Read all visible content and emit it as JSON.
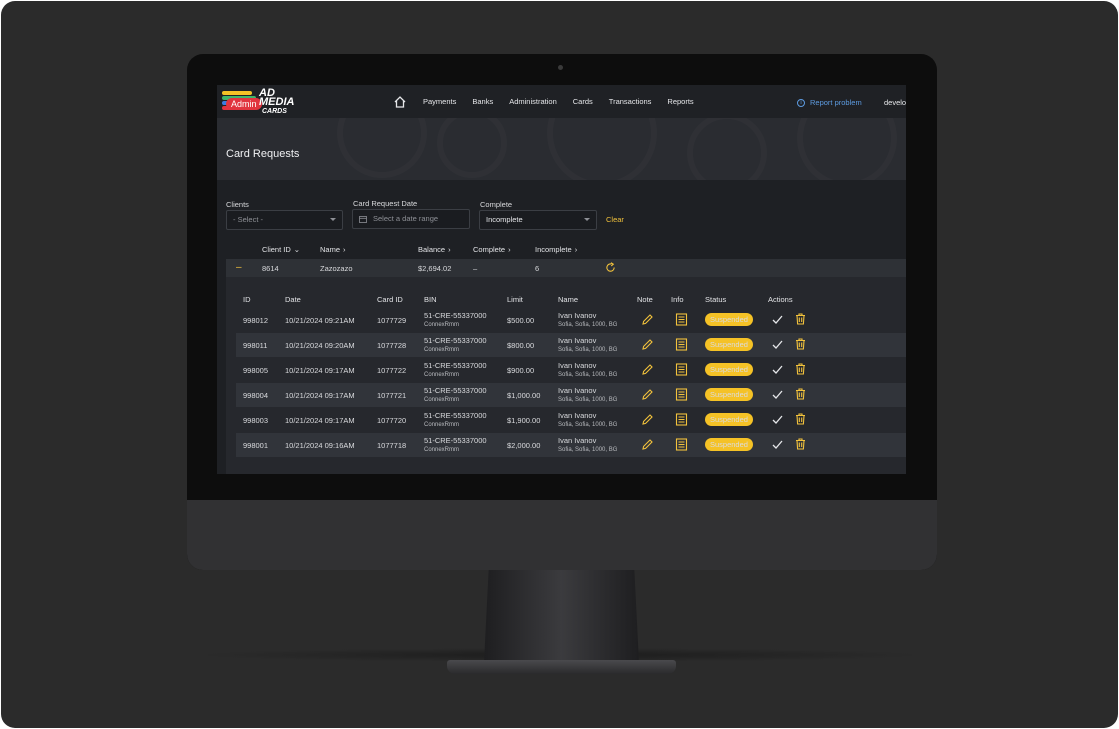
{
  "app": {
    "logo_badge": "Admin",
    "logo_line1": "AD",
    "logo_line2": "MEDIA",
    "logo_line3": "CARDS"
  },
  "nav": {
    "items": [
      "Payments",
      "Banks",
      "Administration",
      "Cards",
      "Transactions",
      "Reports"
    ],
    "report_problem": "Report problem",
    "user": "develo"
  },
  "page": {
    "title": "Card Requests"
  },
  "filters": {
    "clients_label": "Clients",
    "clients_value": "- Select -",
    "date_label": "Card Request Date",
    "date_placeholder": "Select a date range",
    "complete_label": "Complete",
    "complete_value": "Incomplete",
    "clear": "Clear"
  },
  "summary": {
    "headers": {
      "client_id": "Client ID",
      "name": "Name",
      "balance": "Balance",
      "complete": "Complete",
      "incomplete": "Incomplete"
    },
    "row": {
      "client_id": "8614",
      "name": "Zazozazo",
      "balance": "$2,694.02",
      "complete": "–",
      "incomplete": "6"
    }
  },
  "table": {
    "headers": {
      "id": "ID",
      "date": "Date",
      "card_id": "Card ID",
      "bin": "BIN",
      "limit": "Limit",
      "name": "Name",
      "note": "Note",
      "info": "Info",
      "status": "Status",
      "actions": "Actions"
    },
    "rows": [
      {
        "id": "998012",
        "date": "10/21/2024 09:21AM",
        "card_id": "1077729",
        "bin": "51-CRE-55337000",
        "bin_sub": "ConnexRmm",
        "limit": "$500.00",
        "name": "Ivan Ivanov",
        "address": "Sofia, Sofia, 1000, BG",
        "status": "Suspended"
      },
      {
        "id": "998011",
        "date": "10/21/2024 09:20AM",
        "card_id": "1077728",
        "bin": "51-CRE-55337000",
        "bin_sub": "ConnexRmm",
        "limit": "$800.00",
        "name": "Ivan Ivanov",
        "address": "Sofia, Sofia, 1000, BG",
        "status": "Suspended"
      },
      {
        "id": "998005",
        "date": "10/21/2024 09:17AM",
        "card_id": "1077722",
        "bin": "51-CRE-55337000",
        "bin_sub": "ConnexRmm",
        "limit": "$900.00",
        "name": "Ivan Ivanov",
        "address": "Sofia, Sofia, 1000, BG",
        "status": "Suspended"
      },
      {
        "id": "998004",
        "date": "10/21/2024 09:17AM",
        "card_id": "1077721",
        "bin": "51-CRE-55337000",
        "bin_sub": "ConnexRmm",
        "limit": "$1,000.00",
        "name": "Ivan Ivanov",
        "address": "Sofia, Sofia, 1000, BG",
        "status": "Suspended"
      },
      {
        "id": "998003",
        "date": "10/21/2024 09:17AM",
        "card_id": "1077720",
        "bin": "51-CRE-55337000",
        "bin_sub": "ConnexRmm",
        "limit": "$1,900.00",
        "name": "Ivan Ivanov",
        "address": "Sofia, Sofia, 1000, BG",
        "status": "Suspended"
      },
      {
        "id": "998001",
        "date": "10/21/2024 09:16AM",
        "card_id": "1077718",
        "bin": "51-CRE-55337000",
        "bin_sub": "ConnexRmm",
        "limit": "$2,000.00",
        "name": "Ivan Ivanov",
        "address": "Sofia, Sofia, 1000, BG",
        "status": "Suspended"
      }
    ]
  },
  "icons": {
    "home": "home-icon",
    "info": "info-icon",
    "edit": "pencil-icon",
    "doc": "document-icon",
    "approve": "check-icon",
    "delete": "trash-icon",
    "refresh": "refresh-icon",
    "calendar": "calendar-icon"
  },
  "colors": {
    "accent": "#f5c226",
    "link": "#5d9be0",
    "admin_badge": "#e1343f",
    "background": "#1e2024"
  }
}
